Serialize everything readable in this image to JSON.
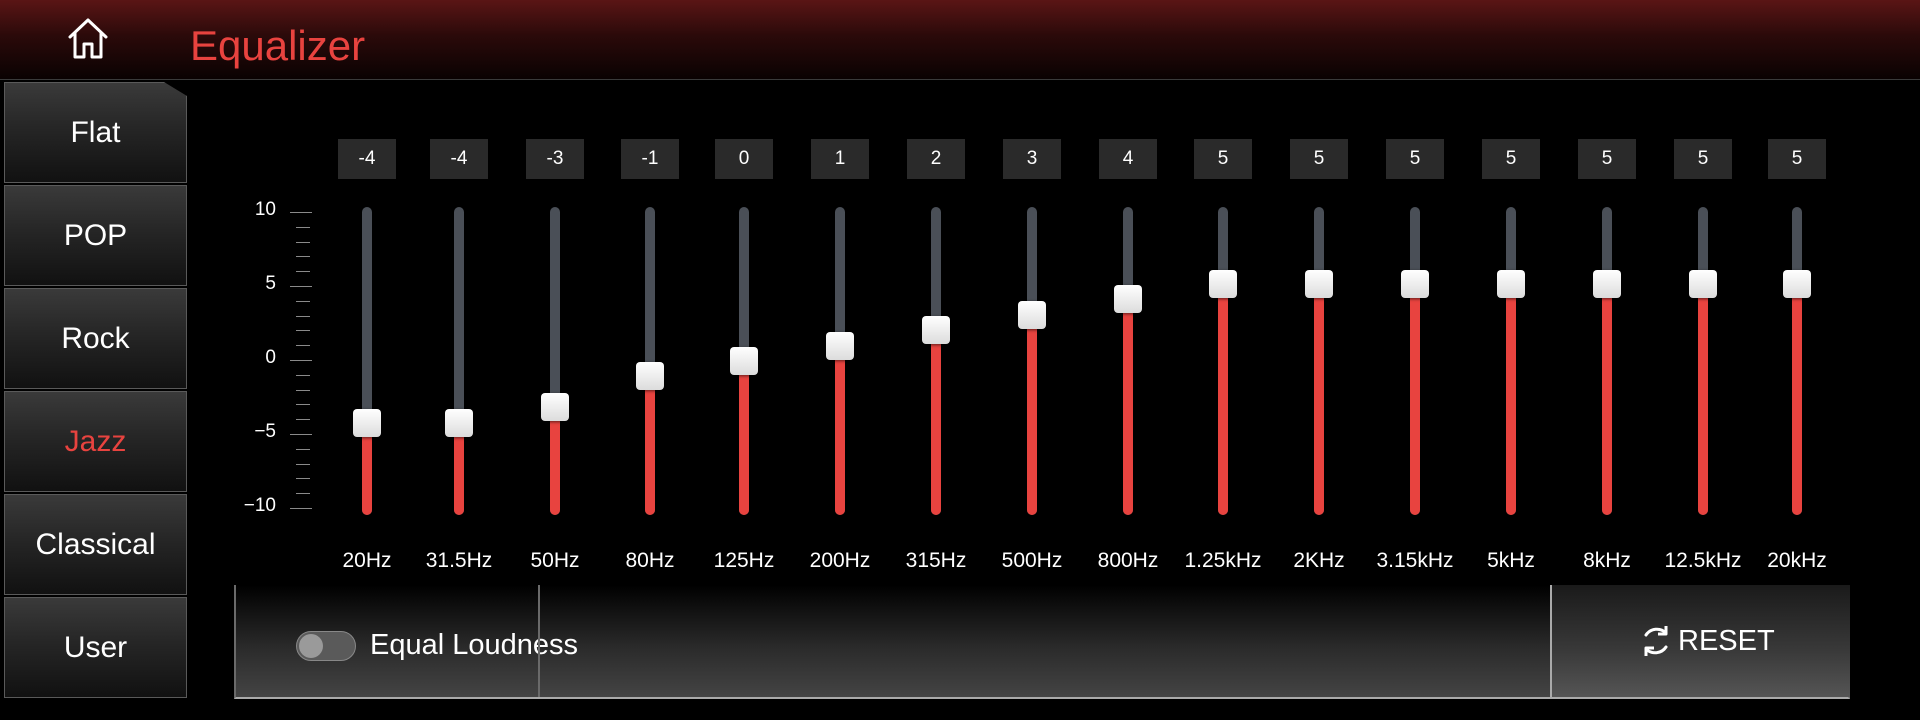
{
  "header": {
    "title": "Equalizer",
    "home_icon": "home-icon"
  },
  "presets": [
    "Flat",
    "POP",
    "Rock",
    "Jazz",
    "Classical",
    "User"
  ],
  "active_preset": "Jazz",
  "scale": {
    "labels": [
      "10",
      "5",
      "0",
      "−5",
      "−10"
    ],
    "min": -10,
    "max": 10
  },
  "bands": [
    {
      "freq": "20Hz",
      "value": "-4",
      "level": -4
    },
    {
      "freq": "31.5Hz",
      "value": "-4",
      "level": -4
    },
    {
      "freq": "50Hz",
      "value": "-3",
      "level": -3
    },
    {
      "freq": "80Hz",
      "value": "-1",
      "level": -1
    },
    {
      "freq": "125Hz",
      "value": "0",
      "level": 0
    },
    {
      "freq": "200Hz",
      "value": "1",
      "level": 1
    },
    {
      "freq": "315Hz",
      "value": "2",
      "level": 2
    },
    {
      "freq": "500Hz",
      "value": "3",
      "level": 3
    },
    {
      "freq": "800Hz",
      "value": "4",
      "level": 4
    },
    {
      "freq": "1.25kHz",
      "value": "5",
      "level": 5
    },
    {
      "freq": "2KHz",
      "value": "5",
      "level": 5
    },
    {
      "freq": "3.15kHz",
      "value": "5",
      "level": 5
    },
    {
      "freq": "5kHz",
      "value": "5",
      "level": 5
    },
    {
      "freq": "8kHz",
      "value": "5",
      "level": 5
    },
    {
      "freq": "12.5kHz",
      "value": "5",
      "level": 5
    },
    {
      "freq": "20kHz",
      "value": "5",
      "level": 5
    }
  ],
  "bottom": {
    "loudness_label": "Equal Loudness",
    "loudness_on": false,
    "reset_label": "RESET"
  },
  "colors": {
    "accent": "#e8433f",
    "track": "#4a4f57",
    "header_top": "#5a1515"
  }
}
